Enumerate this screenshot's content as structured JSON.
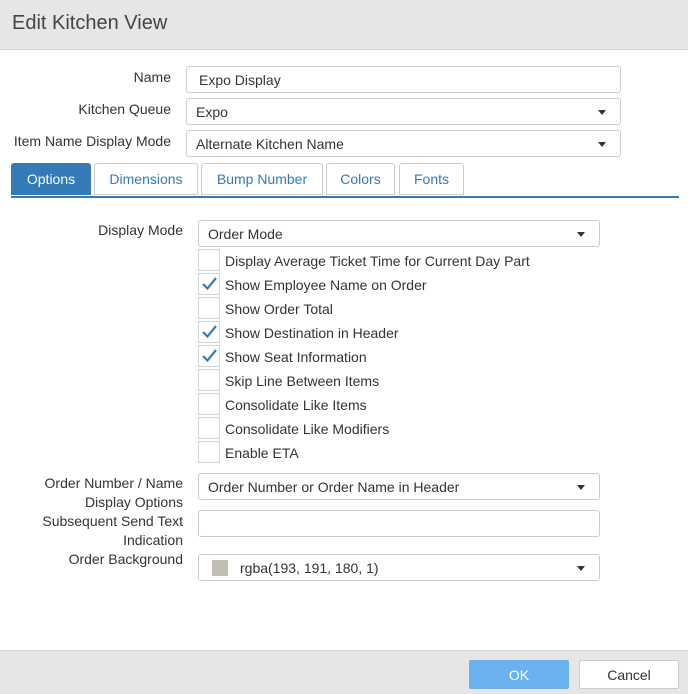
{
  "dialog": {
    "title": "Edit Kitchen View"
  },
  "fields": {
    "name": {
      "label": "Name",
      "value": "Expo Display"
    },
    "kitchen_queue": {
      "label": "Kitchen Queue",
      "value": "Expo"
    },
    "item_name_display_mode": {
      "label": "Item Name Display Mode",
      "value": "Alternate Kitchen Name"
    }
  },
  "tabs": [
    {
      "label": "Options",
      "active": true
    },
    {
      "label": "Dimensions",
      "active": false
    },
    {
      "label": "Bump Number",
      "active": false
    },
    {
      "label": "Colors",
      "active": false
    },
    {
      "label": "Fonts",
      "active": false
    }
  ],
  "options": {
    "display_mode": {
      "label": "Display Mode",
      "value": "Order Mode"
    },
    "checkboxes": [
      {
        "label": "Display Average Ticket Time for Current Day Part",
        "checked": false
      },
      {
        "label": "Show Employee Name on Order",
        "checked": true
      },
      {
        "label": "Show Order Total",
        "checked": false
      },
      {
        "label": "Show Destination in Header",
        "checked": true
      },
      {
        "label": "Show Seat Information",
        "checked": true
      },
      {
        "label": "Skip Line Between Items",
        "checked": false
      },
      {
        "label": "Consolidate Like Items",
        "checked": false
      },
      {
        "label": "Consolidate Like Modifiers",
        "checked": false
      },
      {
        "label": "Enable ETA",
        "checked": false
      }
    ],
    "order_number_display": {
      "label_line1": "Order Number / Name",
      "label_line2": "Display Options",
      "value": "Order Number or Order Name in Header"
    },
    "subsequent_send": {
      "label_line1": "Subsequent Send Text",
      "label_line2": "Indication",
      "value": ""
    },
    "order_background": {
      "label": "Order Background",
      "value": "rgba(193, 191, 180, 1)",
      "swatch_color": "#c1bfb4"
    }
  },
  "footer": {
    "ok_label": "OK",
    "cancel_label": "Cancel"
  },
  "colors": {
    "accent": "#337ab7",
    "ok_button": "#69b2ef",
    "check": "#337ab7"
  }
}
